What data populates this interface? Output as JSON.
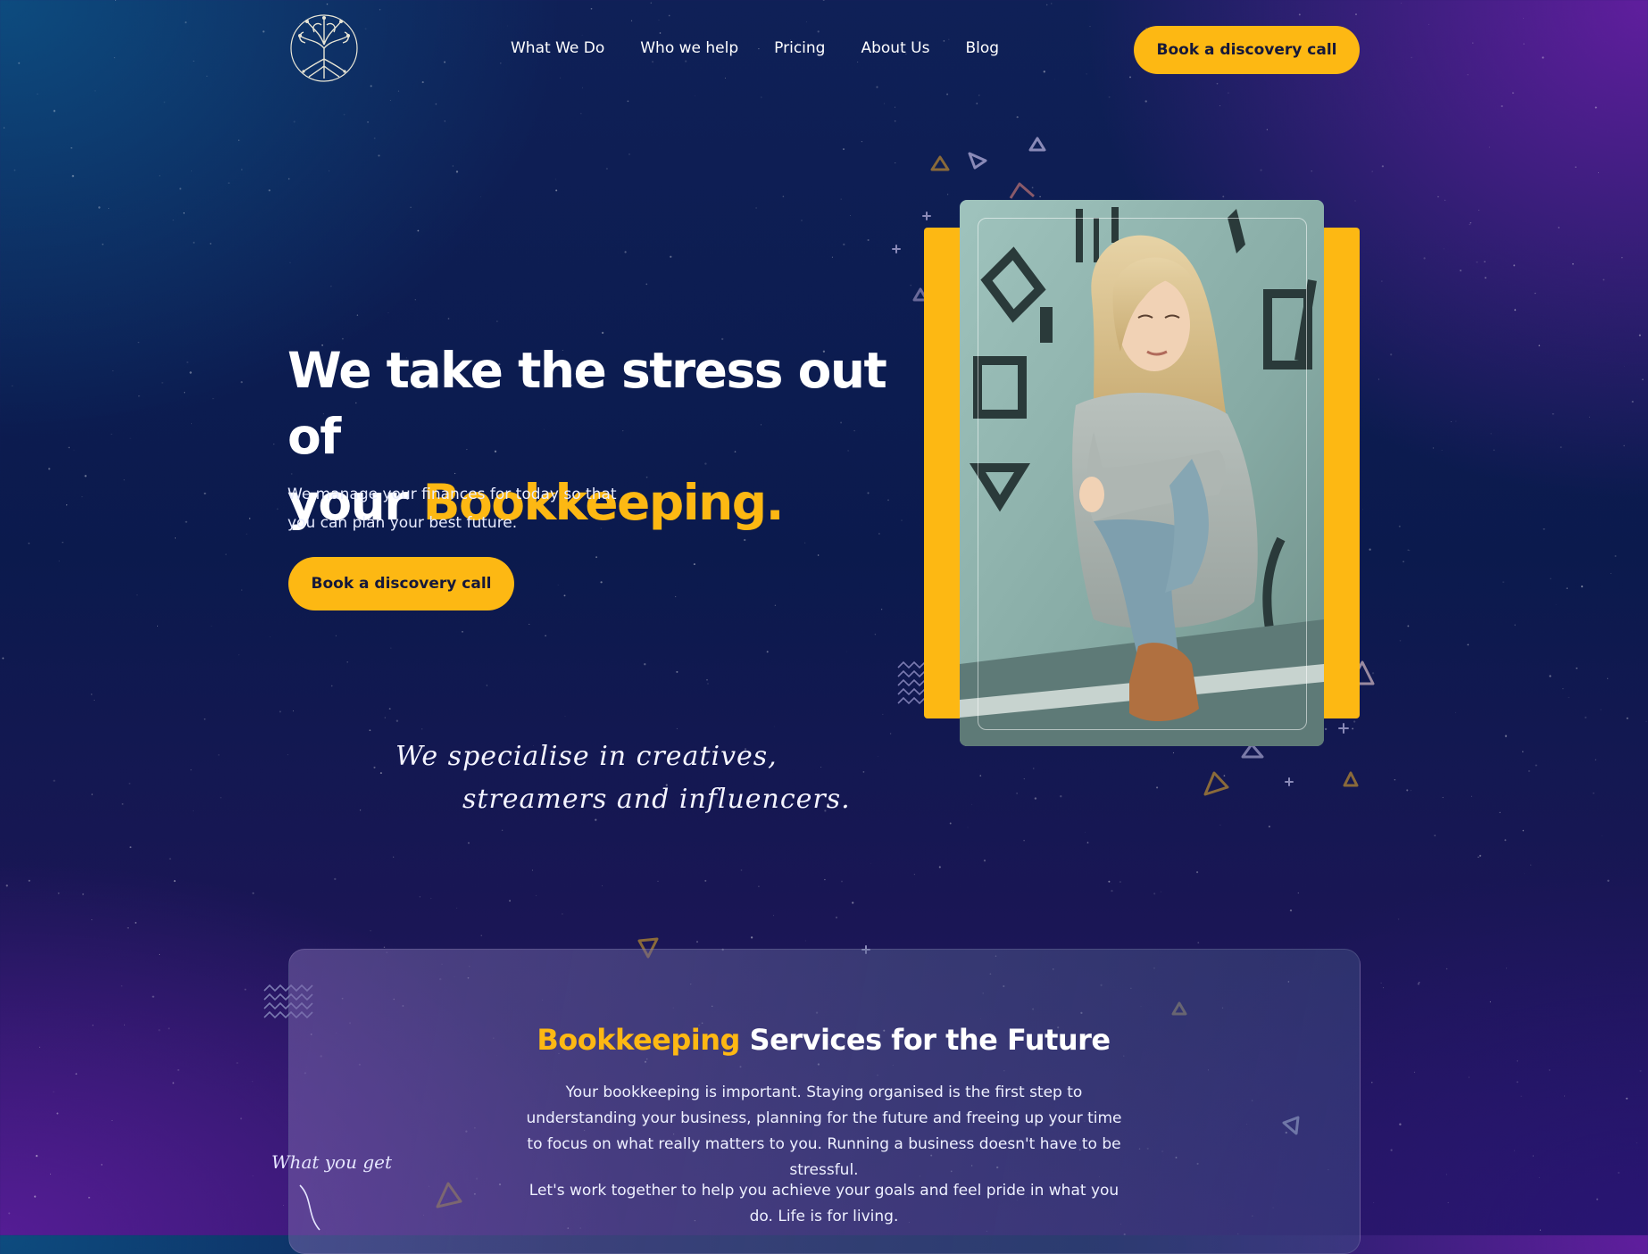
{
  "nav": {
    "logo_icon": "tree-of-life-logo",
    "links": [
      "What We Do",
      "Who we help",
      "Pricing",
      "About Us",
      "Blog"
    ],
    "cta_label": "Book a discovery call"
  },
  "hero": {
    "title_line1": "We take the stress out of",
    "title_line2_prefix": "your ",
    "title_line2_accent": "Bookkeeping.",
    "subtitle_line1": "We manage your finances for today so that",
    "subtitle_line2": "you can plan your best future.",
    "cta_label": "Book a discovery call",
    "script_line1": "We specialise in creatives,",
    "script_line2": "streamers and influencers."
  },
  "services": {
    "title_accent": "Bookkeeping",
    "title_rest": " Services for the Future",
    "para1": "Your bookkeeping is important. Staying organised is the first step to understanding your business, planning for the future and freeing up your time to focus on what really matters to you. Running a business doesn't have to be stressful.",
    "para2": "Let's work together to help you achieve your goals and feel pride in what you do. Life is for living.",
    "script_note": "What you get"
  },
  "colors": {
    "accent": "#fdb813",
    "background": "#0f2057",
    "text": "#ffffff",
    "button_text": "#15183a"
  }
}
